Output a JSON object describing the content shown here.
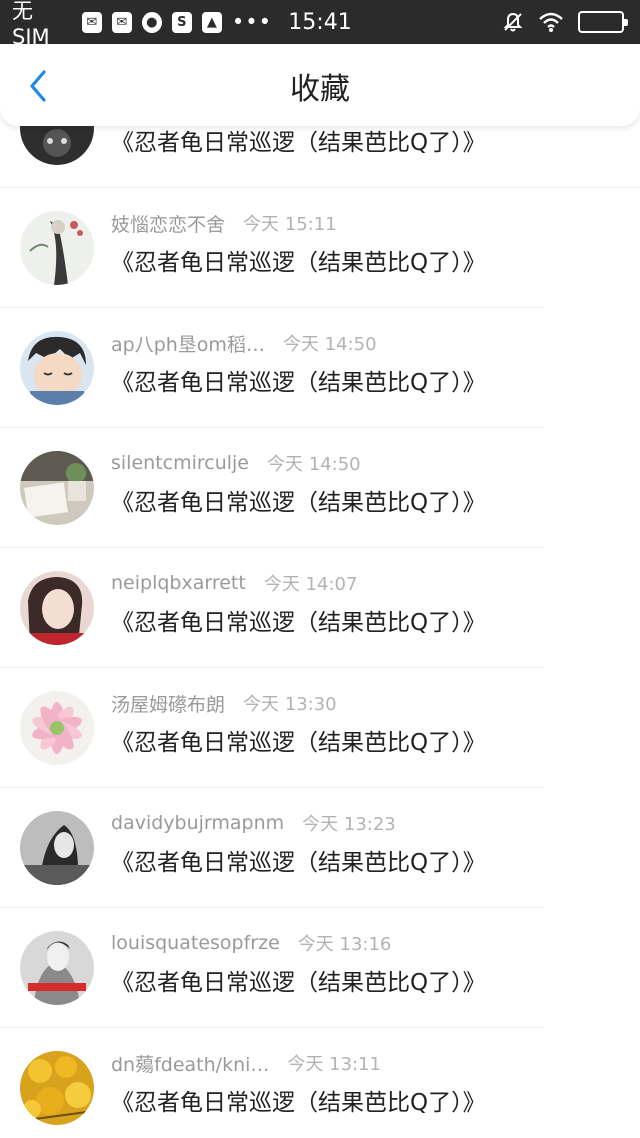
{
  "status_bar": {
    "carrier": "无SIM",
    "time": "15:41",
    "overflow": "•••",
    "icons": [
      "mail-icon",
      "mail-icon",
      "palette-icon",
      "s-app-icon",
      "image-icon",
      "mute-icon",
      "wifi-icon",
      "battery-icon"
    ]
  },
  "header": {
    "title": "收藏",
    "back_icon": "chevron-left-icon",
    "accent_color": "#1e88e5"
  },
  "items": [
    {
      "username": "",
      "time": "",
      "message": "《忍者龟日常巡逻（结果芭比Q了）》",
      "avatar": "dark-avatar"
    },
    {
      "username": "妓惱恋恋不舍",
      "time": "今天 15:11",
      "message": "《忍者龟日常巡逻（结果芭比Q了）》",
      "avatar": "ink-painting-avatar"
    },
    {
      "username": "ap八ph垦om稻…",
      "time": "今天 14:50",
      "message": "《忍者龟日常巡逻（结果芭比Q了）》",
      "avatar": "anime-avatar"
    },
    {
      "username": "silentcmirculje",
      "time": "今天 14:50",
      "message": "《忍者龟日常巡逻（结果芭比Q了）》",
      "avatar": "desk-avatar"
    },
    {
      "username": "neiplqbxarrett",
      "time": "今天 14:07",
      "message": "《忍者龟日常巡逻（结果芭比Q了）》",
      "avatar": "portrait-avatar"
    },
    {
      "username": "汤屋姆礤布朗",
      "time": "今天 13:30",
      "message": "《忍者龟日常巡逻（结果芭比Q了）》",
      "avatar": "flower-avatar"
    },
    {
      "username": "davidybujrmapnm",
      "time": "今天 13:23",
      "message": "《忍者龟日常巡逻（结果芭比Q了）》",
      "avatar": "bw-photo-avatar"
    },
    {
      "username": "louisquatesopfrze",
      "time": "今天 13:16",
      "message": "《忍者龟日常巡逻（结果芭比Q了）》",
      "avatar": "man-avatar"
    },
    {
      "username": "dn薚fdeath/kni…",
      "time": "今天 13:11",
      "message": "《忍者龟日常巡逻（结果芭比Q了）》",
      "avatar": "yellow-flower-avatar"
    }
  ]
}
